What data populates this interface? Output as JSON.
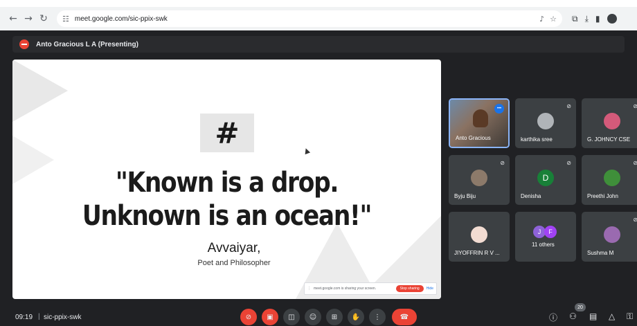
{
  "browser": {
    "url": "meet.google.com/sic-ppix-swk",
    "icons": [
      "back-icon",
      "forward-icon",
      "reload-icon",
      "tune-icon",
      "mic-icon",
      "star-icon",
      "extensions-icon",
      "download-icon",
      "sidepanel-icon",
      "profile-icon"
    ]
  },
  "presenting": {
    "label": "Anto Gracious L A (Presenting)"
  },
  "slide": {
    "hash": "#",
    "quote_line1": "\"Known is a drop.",
    "quote_line2": "Unknown is an ocean!\"",
    "author": "Avvaiyar,",
    "author_role": "Poet and Philosopher",
    "sharing_text": "meet.google.com is sharing your screen.",
    "stop_sharing": "Stop sharing",
    "hide": "Hide"
  },
  "participants": [
    {
      "name": "Anto Gracious L A",
      "display": "Anto Gracious",
      "type": "video",
      "speaking": true
    },
    {
      "name": "karthika sree",
      "type": "photo",
      "color": "#b0b4b8"
    },
    {
      "name": "G. JOHNCY CSE",
      "type": "photo",
      "color": "#d45a7a"
    },
    {
      "name": "Byju Biju",
      "type": "photo",
      "color": "#8c7a6a"
    },
    {
      "name": "Denisha",
      "type": "letter",
      "letter": "D",
      "color": "#188038"
    },
    {
      "name": "Preethi John",
      "type": "photo",
      "color": "#3f8f3a"
    },
    {
      "name": "JIYOFFRIN R V ...",
      "type": "photo",
      "color": "#f2dcd2"
    },
    {
      "name": "11 others",
      "type": "others",
      "letters": [
        "J",
        "F"
      ],
      "colors": [
        "#8e62d8",
        "#a142f4"
      ]
    },
    {
      "name": "Sushma M",
      "type": "photo",
      "color": "#9a6ab0"
    }
  ],
  "bottom": {
    "time": "09:19",
    "separator": "|",
    "meeting_code": "sic-ppix-swk",
    "people_count": "20"
  }
}
